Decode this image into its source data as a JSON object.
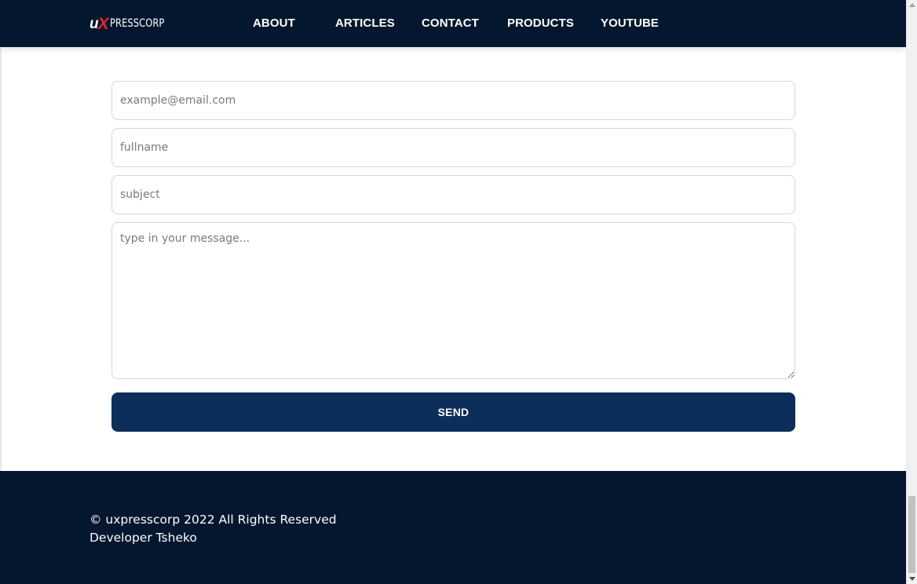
{
  "logo": {
    "part1": "u",
    "part2": "X",
    "part3": "PRESSCORP",
    "accent_color": "#e3262b"
  },
  "nav": {
    "about": "ABOUT",
    "articles": "ARTICLES",
    "contact": "CONTACT",
    "products": "PRODUCTS",
    "youtube": "YOUTUBE"
  },
  "form": {
    "email_placeholder": "example@email.com",
    "fullname_placeholder": "fullname",
    "subject_placeholder": "subject",
    "message_placeholder": "type in your message...",
    "send_label": "SEND"
  },
  "footer": {
    "copyright": "© uxpresscorp 2022 All Rights Reserved",
    "developer": "Developer Tsheko"
  },
  "colors": {
    "navy": "#04172e",
    "button": "#0b2f58"
  }
}
